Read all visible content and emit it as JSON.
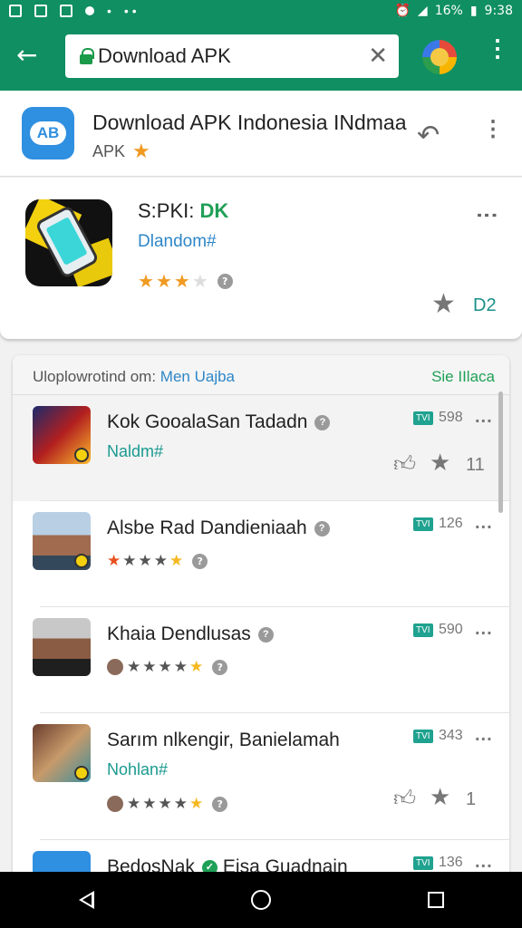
{
  "status": {
    "battery": "16%",
    "time": "9:38"
  },
  "browser": {
    "url_text": "Download APK"
  },
  "app_header": {
    "title": "Download APK Indonesia INdmaa",
    "subtitle": "APK"
  },
  "featured": {
    "title_prefix": "S:PKI:",
    "title_accent": "DK",
    "subtitle": "Dlandom#",
    "rating_stars": 3,
    "info_badge": "?",
    "star_count": "D2"
  },
  "list": {
    "header_left": "Uloplowrotind om:",
    "header_left_accent": "Men Uajba",
    "header_right": "Sie IIlaca",
    "rows": [
      {
        "title": "Kok GooalaSan Tadadn",
        "subtitle": "Naldm#",
        "badge": "TVI",
        "count": "598",
        "actions_count": "11"
      },
      {
        "title": "Alsbe Rad Dandieniaah",
        "badge": "TVI",
        "count": "126",
        "rating_stars": 4
      },
      {
        "title": "Khaia Dendlusas",
        "badge": "TVI",
        "count": "590",
        "rating_stars": 4
      },
      {
        "title": "Sarım nlkengir, Banielamah",
        "subtitle": "Nohlan#",
        "badge": "TVI",
        "count": "343",
        "rating_stars": 4,
        "actions_count": "1"
      },
      {
        "title": "BedosNak",
        "title_tail": "Eisa Guadnain",
        "badge": "TVI",
        "count": "136"
      }
    ]
  },
  "colors": {
    "toolbar": "#0f8f62",
    "accent_green": "#1fa057",
    "link_blue": "#2e86c8",
    "star_orange": "#f19a22"
  }
}
